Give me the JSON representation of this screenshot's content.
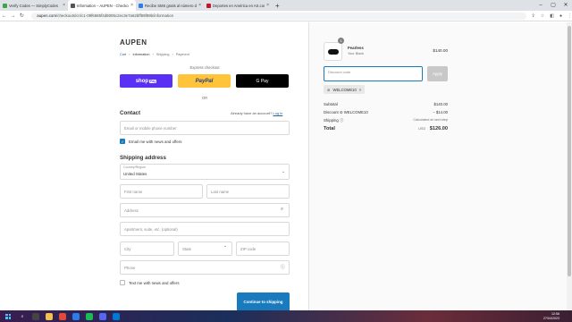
{
  "browser": {
    "tabs": [
      {
        "title": "Verify Codes — SimplyCodes",
        "color": "#3fa34d"
      },
      {
        "title": "Information – AUPEN - Checkout",
        "color": "#555555"
      },
      {
        "title": "Recibe SMS gratis al número de",
        "color": "#2b7de9"
      },
      {
        "title": "Deportes en América en AS.com",
        "color": "#c8102e"
      }
    ],
    "new_tab": "+",
    "url_host": "aupen.com",
    "url_path": "/checkouts/cn/c1-09f6685f4d8005c2ec3e7a62bff89f89b/information"
  },
  "checkout": {
    "brand": "AUPEN",
    "breadcrumb": [
      "Cart",
      "Information",
      "Shipping",
      "Payment"
    ],
    "express_label": "Express checkout",
    "shop_pay": "shop",
    "shop_pay_badge": "Pay",
    "paypal": "PayPal",
    "gpay": "G Pay",
    "or_label": "OR",
    "contact_heading": "Contact",
    "have_account": "Already have an account?",
    "login_link": "Log in",
    "email_placeholder": "Email or mobile phone number",
    "email_news": "Email me with news and offers",
    "shipping_heading": "Shipping address",
    "country_label": "Country/Region",
    "country_value": "United States",
    "first_name": "First name",
    "last_name": "Last name",
    "address": "Address",
    "apartment": "Apartment, suite, etc. (optional)",
    "city": "City",
    "state": "State",
    "zip": "ZIP code",
    "phone": "Phone",
    "text_news": "Text me with news and offers",
    "continue_button": "Continue to shipping"
  },
  "summary": {
    "product_name": "Fearless",
    "product_variant": "Your Black",
    "product_price": "$140.00",
    "quantity": "1",
    "discount_placeholder": "Discount code",
    "apply_button": "Apply",
    "applied_code": "WELCOME10",
    "subtotal_label": "Subtotal",
    "subtotal_value": "$140.00",
    "discount_label": "Discount",
    "discount_code": "WELCOME10",
    "discount_value": "− $14.00",
    "shipping_label": "Shipping",
    "shipping_value": "Calculated at next step",
    "total_label": "Total",
    "total_currency": "USD",
    "total_value": "$126.00"
  },
  "taskbar": {
    "time": "12:56",
    "date": "27/04/2023"
  }
}
